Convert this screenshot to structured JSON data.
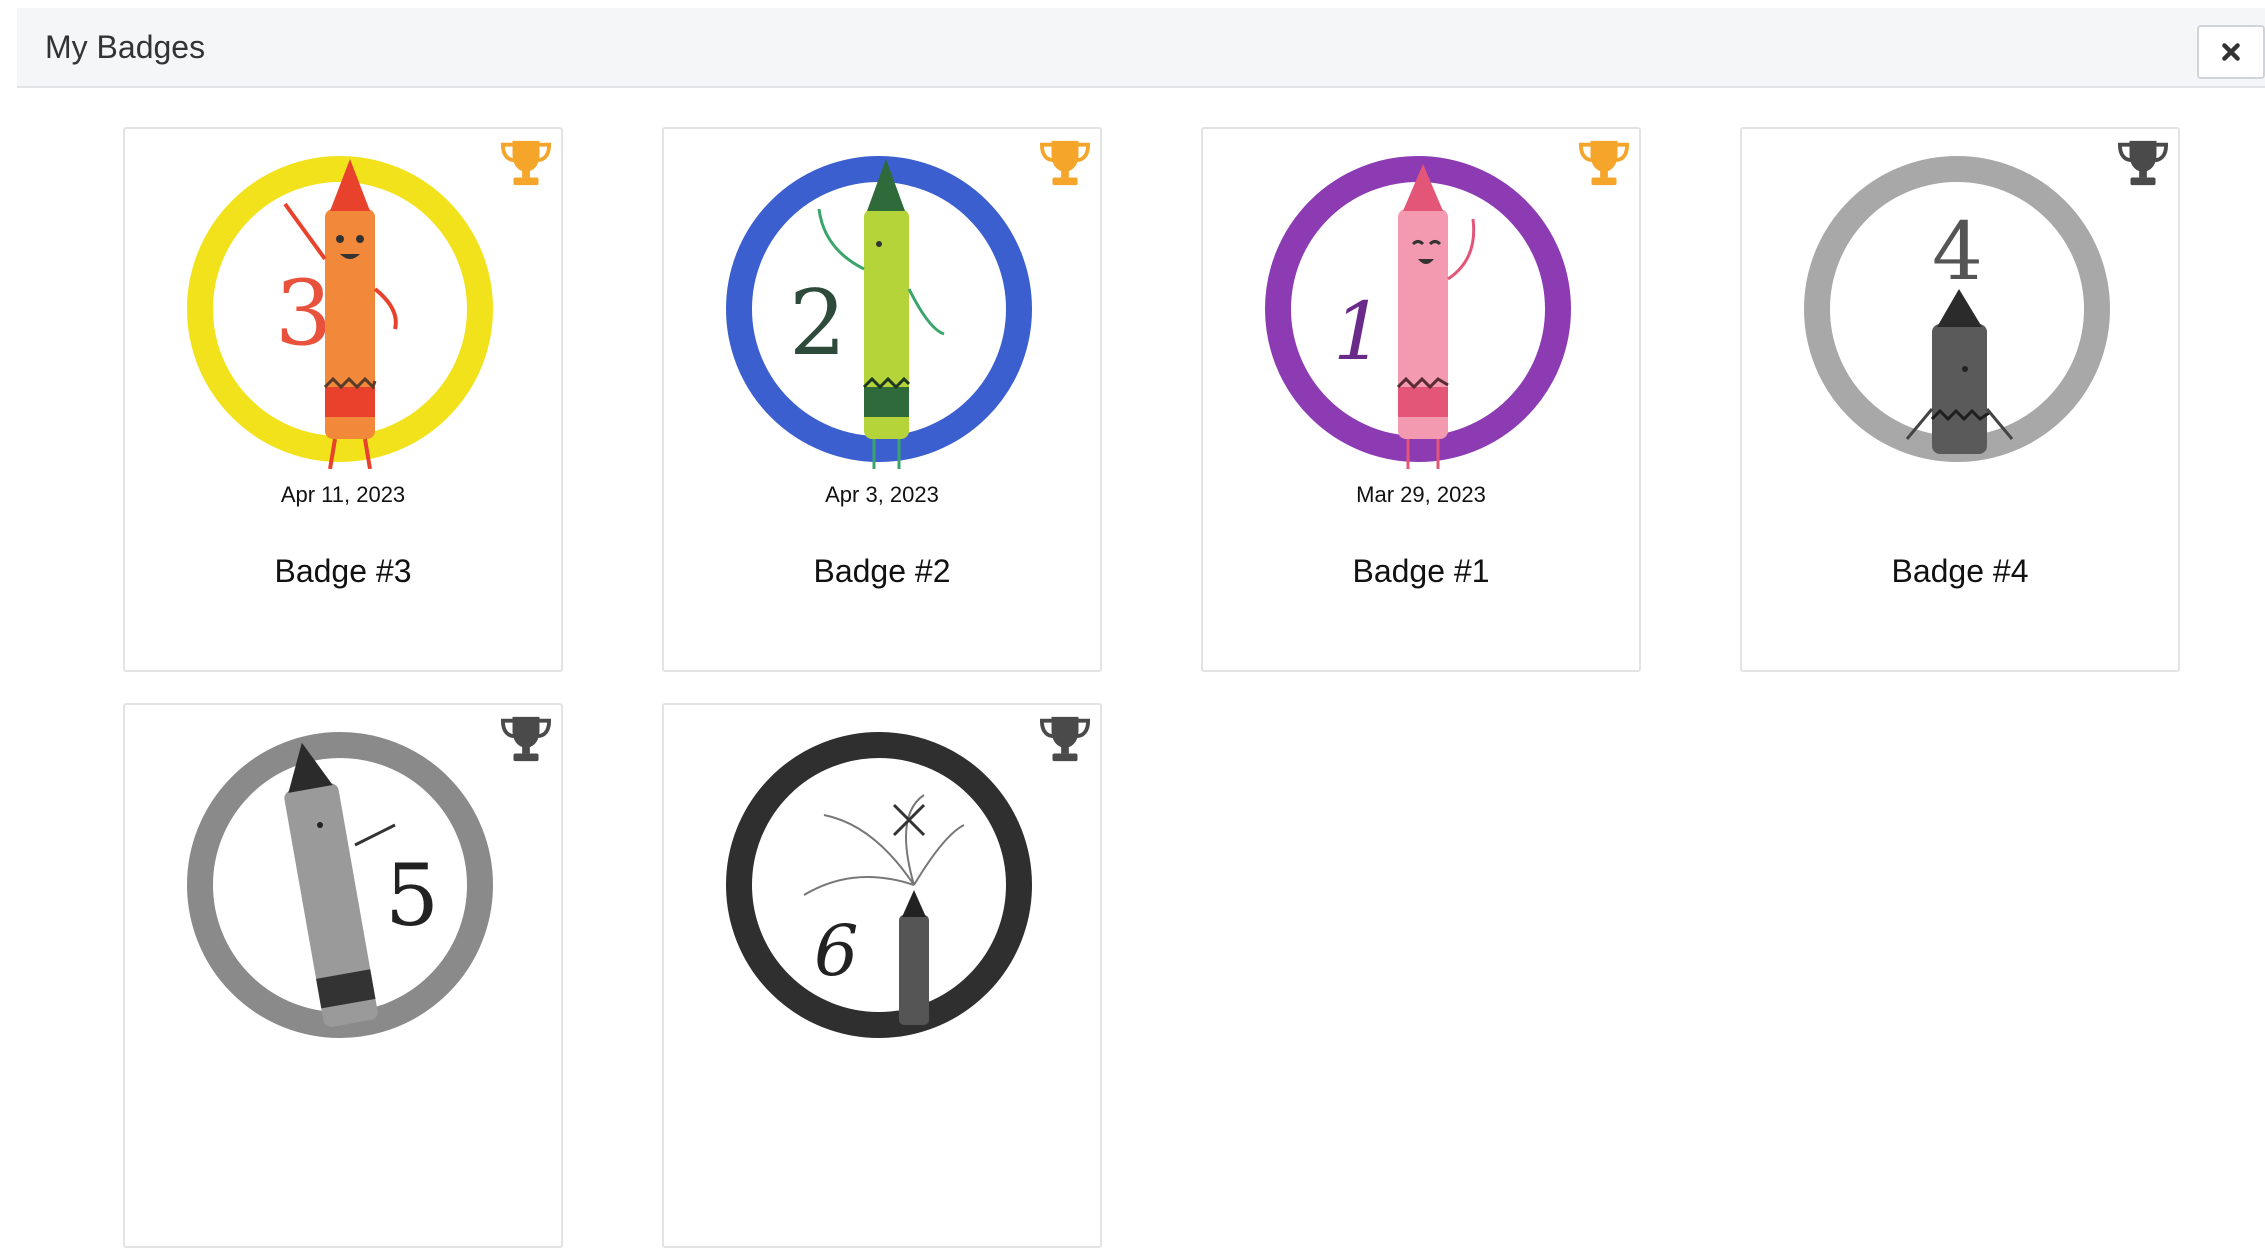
{
  "modal": {
    "title": "My Badges",
    "close_icon": "close-icon"
  },
  "colors": {
    "trophy_earned": "#f4a52a",
    "trophy_locked": "#4a4a4a",
    "yellow": "#f2e21b",
    "orange": "#f2893a",
    "blue": "#3c5fcf",
    "green": "#b5d43a",
    "purple": "#8c3bb3",
    "pink": "#f49ab0",
    "gray": "#9a9a9a",
    "dark": "#2b2b2b"
  },
  "badges": [
    {
      "name": "Badge #3",
      "date": "Apr 11, 2023",
      "earned": true,
      "number": "3",
      "ring": "#f2e21b",
      "crayon": "#f2893a",
      "tip": "#e8422c",
      "crayon_label": "ORANGE"
    },
    {
      "name": "Badge #2",
      "date": "Apr 3, 2023",
      "earned": true,
      "number": "2",
      "ring": "#3c5fcf",
      "crayon": "#b5d43a",
      "tip": "#2f6b3a",
      "crayon_label": "GREEN"
    },
    {
      "name": "Badge #1",
      "date": "Mar 29, 2023",
      "earned": true,
      "number": "1",
      "ring": "#8c3bb3",
      "crayon": "#f49ab0",
      "tip": "#e45677",
      "crayon_label": "PINK"
    },
    {
      "name": "Badge #4",
      "date": "",
      "earned": false,
      "number": "4",
      "ring": "#a8a8a8",
      "crayon": "#5a5a5a",
      "tip": "#2b2b2b",
      "crayon_label": ""
    },
    {
      "name": "",
      "date": "",
      "earned": false,
      "number": "5",
      "ring": "#8a8a8a",
      "crayon": "#9a9a9a",
      "tip": "#2b2b2b",
      "crayon_label": "BLACK"
    },
    {
      "name": "",
      "date": "",
      "earned": false,
      "number": "6",
      "ring": "#2f2f2f",
      "crayon": "#555555",
      "tip": "#222222",
      "crayon_label": ""
    }
  ]
}
